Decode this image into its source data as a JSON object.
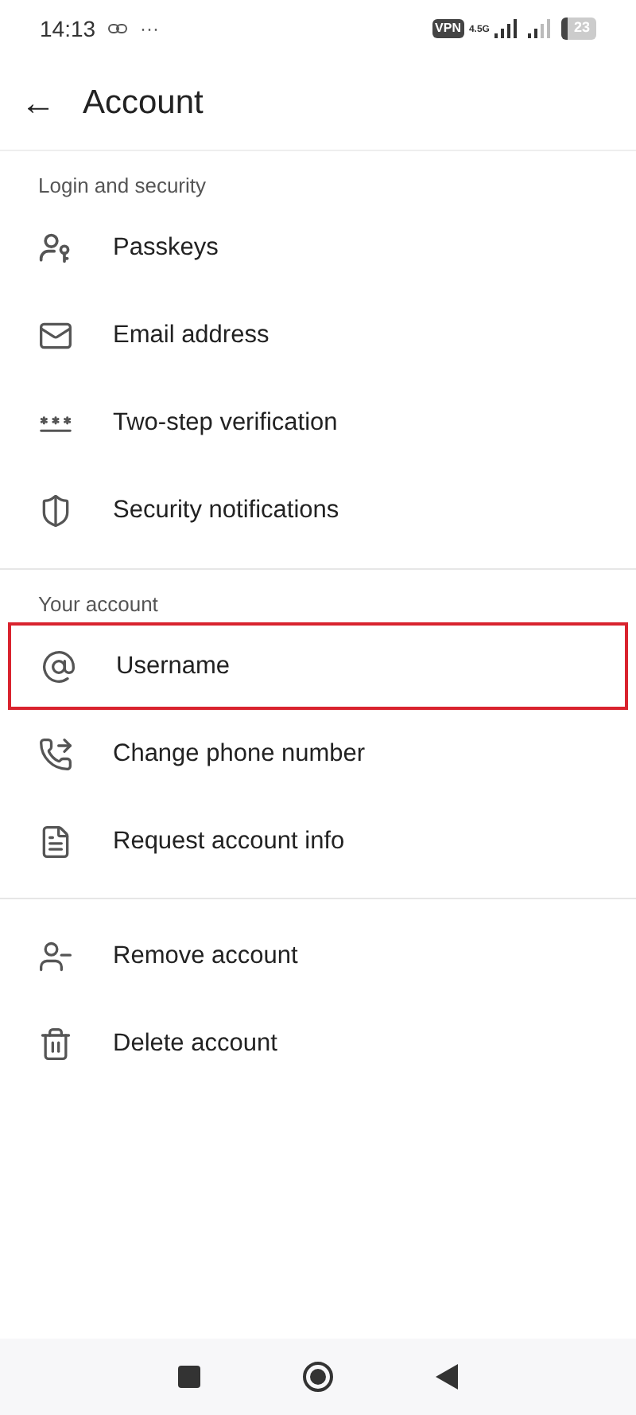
{
  "status_bar": {
    "time": "14:13",
    "dots": "···",
    "vpn": "VPN",
    "network": "4.5G",
    "battery": "23"
  },
  "header": {
    "back": "←",
    "title": "Account"
  },
  "sections": [
    {
      "title": "Login and security",
      "items": [
        {
          "label": "Passkeys",
          "highlighted": false
        },
        {
          "label": "Email address",
          "highlighted": false
        },
        {
          "label": "Two-step verification",
          "highlighted": false
        },
        {
          "label": "Security notifications",
          "highlighted": false
        }
      ]
    },
    {
      "title": "Your account",
      "items": [
        {
          "label": "Username",
          "highlighted": true
        },
        {
          "label": "Change phone number",
          "highlighted": false
        },
        {
          "label": "Request account info",
          "highlighted": false
        }
      ]
    },
    {
      "items": [
        {
          "label": "Remove account",
          "highlighted": false
        },
        {
          "label": "Delete account",
          "highlighted": false
        }
      ]
    }
  ]
}
